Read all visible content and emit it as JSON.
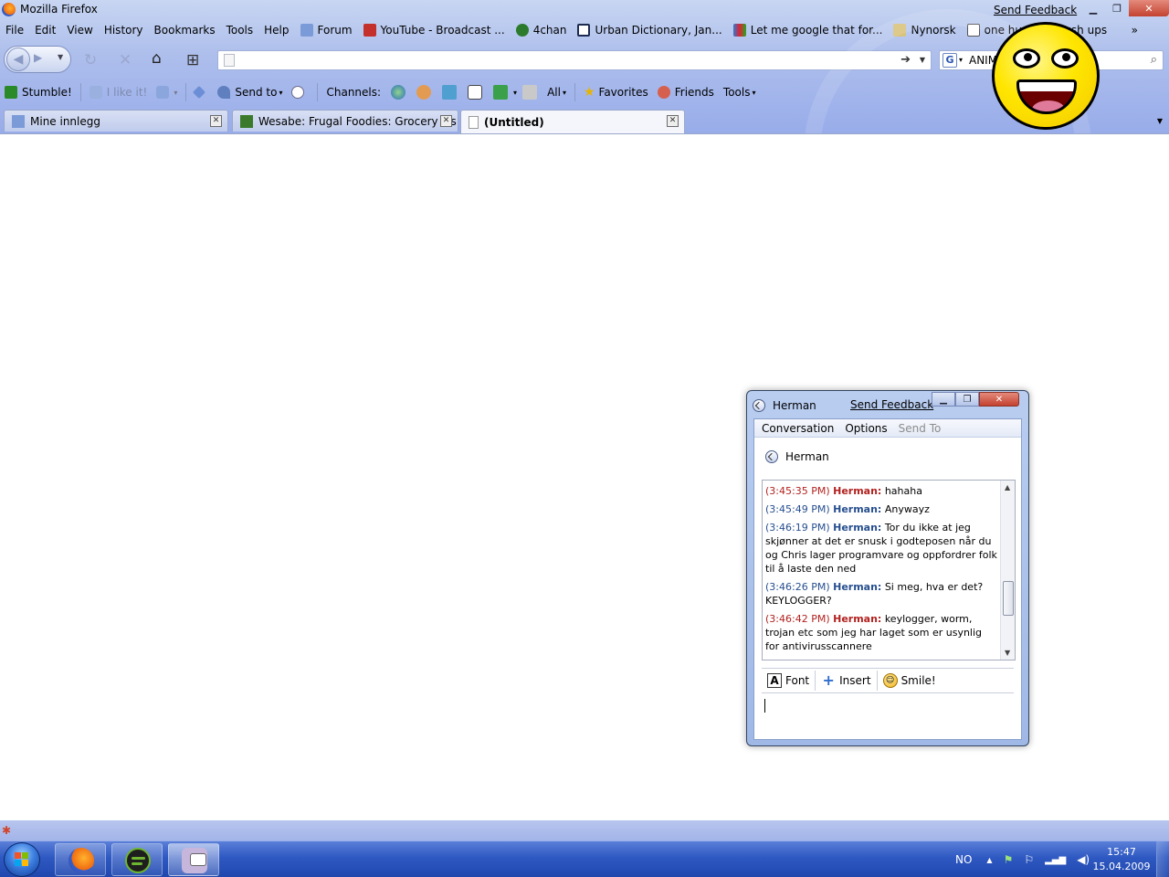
{
  "window": {
    "title": "Mozilla Firefox",
    "send_feedback": "Send Feedback"
  },
  "menu": [
    "File",
    "Edit",
    "View",
    "History",
    "Bookmarks",
    "Tools",
    "Help"
  ],
  "bookmarks": [
    {
      "label": "Forum",
      "icon": "forum-icon",
      "color": "#7b9ad8"
    },
    {
      "label": "YouTube - Broadcast ...",
      "icon": "youtube-icon",
      "color": "#c4302b"
    },
    {
      "label": "4chan",
      "icon": "4chan-icon",
      "color": "#2c7a2c"
    },
    {
      "label": "Urban Dictionary, Jan...",
      "icon": "urban-dictionary-icon",
      "color": "#1d2b50"
    },
    {
      "label": "Let me google that for...",
      "icon": "lmgtfy-icon",
      "color": "#3377cc"
    },
    {
      "label": "Nynorsk",
      "icon": "folder-icon",
      "color": "#d9c27a"
    },
    {
      "label": "one hundred push ups",
      "icon": "pushups-icon",
      "color": "#555555"
    }
  ],
  "bookmarks_more": "»",
  "navigation": {
    "url": "",
    "search_query": "ANIMAL PORN",
    "search_engine_letter": "G"
  },
  "stumble_toolbar": {
    "stumble": "Stumble!",
    "i_like_it": "I like it!",
    "send_to": "Send to",
    "channels": "Channels:",
    "all": "All",
    "favorites": "Favorites",
    "friends": "Friends",
    "tools": "Tools"
  },
  "tabs": [
    {
      "label": "Mine innlegg",
      "active": false
    },
    {
      "label": "Wesabe: Frugal Foodies: Grocery Lis...",
      "active": false
    },
    {
      "label": "(Untitled)",
      "active": true
    }
  ],
  "chat": {
    "title": "Herman",
    "send_feedback": "Send Feedback",
    "menu": {
      "conversation": "Conversation",
      "options": "Options",
      "send_to": "Send To"
    },
    "buddy": "Herman",
    "messages": [
      {
        "time": "(3:45:35 PM)",
        "sender": "Herman:",
        "text": "hahaha",
        "color": "red"
      },
      {
        "time": "(3:45:49 PM)",
        "sender": "Herman:",
        "text": "Anywayz",
        "color": "blue"
      },
      {
        "time": "(3:46:19 PM)",
        "sender": "Herman:",
        "text": "Tor du ikke at jeg skjønner at det er snusk i godteposen når du og Chris lager programvare og oppfordrer folk til å laste den ned",
        "color": "blue"
      },
      {
        "time": "(3:46:26 PM)",
        "sender": "Herman:",
        "text": "Si meg, hva er det? KEYLOGGER?",
        "color": "blue"
      },
      {
        "time": "(3:46:42 PM)",
        "sender": "Herman:",
        "text": "keylogger, worm, trojan etc som jeg har laget som er usynlig for antivirusscannere",
        "color": "red"
      }
    ],
    "toolbar": {
      "font": "Font",
      "insert": "Insert",
      "smile": "Smile!"
    }
  },
  "taskbar": {
    "language": "NO",
    "time": "15:47",
    "date": "15.04.2009",
    "apps": [
      "firefox",
      "spotify",
      "pidgin"
    ]
  }
}
